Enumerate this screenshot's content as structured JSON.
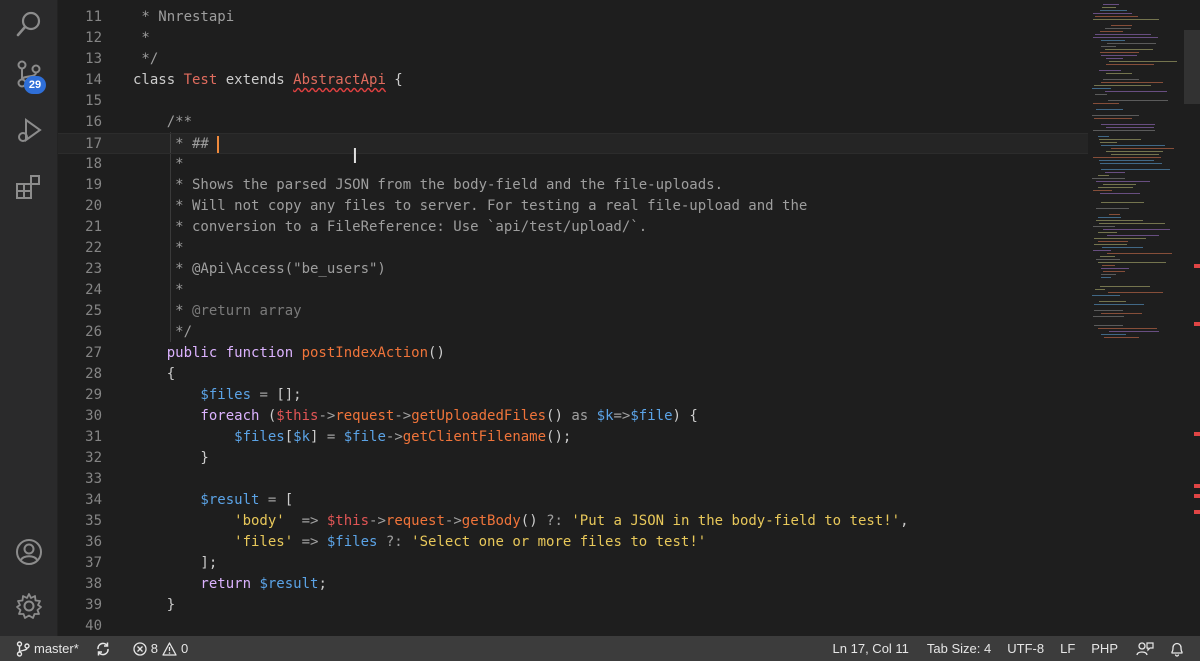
{
  "activity_bar": {
    "scm_badge": "29"
  },
  "editor": {
    "lines": [
      {
        "n": "11",
        "tokens": [
          [
            "cm",
            " * Nnrestapi"
          ]
        ]
      },
      {
        "n": "12",
        "tokens": [
          [
            "cm",
            " *"
          ]
        ]
      },
      {
        "n": "13",
        "tokens": [
          [
            "cm",
            " */"
          ]
        ]
      },
      {
        "n": "14",
        "tokens": [
          [
            "k",
            "class "
          ],
          [
            "cls",
            "Test"
          ],
          [
            "k",
            " extends "
          ],
          [
            "cls squig",
            "AbstractApi"
          ],
          [
            "k",
            " {"
          ]
        ]
      },
      {
        "n": "15",
        "tokens": []
      },
      {
        "n": "16",
        "tokens": [
          [
            "cm",
            "    /**"
          ]
        ]
      },
      {
        "n": "17",
        "tokens": [
          [
            "cm",
            "     * ## "
          ]
        ],
        "caret": true
      },
      {
        "n": "18",
        "tokens": [
          [
            "cm",
            "     *"
          ]
        ]
      },
      {
        "n": "19",
        "tokens": [
          [
            "cm",
            "     * Shows the parsed JSON from the body-field and the file-uploads."
          ]
        ]
      },
      {
        "n": "20",
        "tokens": [
          [
            "cm",
            "     * Will not copy any files to server. For testing a real file-upload and the"
          ]
        ]
      },
      {
        "n": "21",
        "tokens": [
          [
            "cm",
            "     * conversion to a FileReference: Use `api/test/upload/`."
          ]
        ]
      },
      {
        "n": "22",
        "tokens": [
          [
            "cm",
            "     *"
          ]
        ]
      },
      {
        "n": "23",
        "tokens": [
          [
            "cm",
            "     * @Api\\Access(\"be_users\")"
          ]
        ]
      },
      {
        "n": "24",
        "tokens": [
          [
            "cm",
            "     *"
          ]
        ]
      },
      {
        "n": "25",
        "tokens": [
          [
            "cm",
            "     * "
          ],
          [
            "cm2",
            "@return array"
          ]
        ]
      },
      {
        "n": "26",
        "tokens": [
          [
            "cm",
            "     */"
          ]
        ]
      },
      {
        "n": "27",
        "tokens": [
          [
            "kw",
            "    public function "
          ],
          [
            "fn",
            "postIndexAction"
          ],
          [
            "k",
            "()"
          ]
        ]
      },
      {
        "n": "28",
        "tokens": [
          [
            "k",
            "    {"
          ]
        ]
      },
      {
        "n": "29",
        "tokens": [
          [
            "var",
            "        $files"
          ],
          [
            "op",
            " = "
          ],
          [
            "k",
            "[];"
          ]
        ]
      },
      {
        "n": "30",
        "tokens": [
          [
            "kw",
            "        foreach "
          ],
          [
            "k",
            "("
          ],
          [
            "this",
            "$this"
          ],
          [
            "op",
            "->"
          ],
          [
            "fn",
            "request"
          ],
          [
            "op",
            "->"
          ],
          [
            "fn",
            "getUploadedFiles"
          ],
          [
            "k",
            "() "
          ],
          [
            "op",
            "as "
          ],
          [
            "var",
            "$k"
          ],
          [
            "op",
            "=>"
          ],
          [
            "var",
            "$file"
          ],
          [
            "k",
            ") {"
          ]
        ]
      },
      {
        "n": "31",
        "tokens": [
          [
            "var",
            "            $files"
          ],
          [
            "k",
            "["
          ],
          [
            "var",
            "$k"
          ],
          [
            "k",
            "] "
          ],
          [
            "op",
            "= "
          ],
          [
            "var",
            "$file"
          ],
          [
            "op",
            "->"
          ],
          [
            "fn",
            "getClientFilename"
          ],
          [
            "k",
            "();"
          ]
        ]
      },
      {
        "n": "32",
        "tokens": [
          [
            "k",
            "        }"
          ]
        ]
      },
      {
        "n": "33",
        "tokens": []
      },
      {
        "n": "34",
        "tokens": [
          [
            "var",
            "        $result"
          ],
          [
            "op",
            " = "
          ],
          [
            "k",
            "["
          ]
        ]
      },
      {
        "n": "35",
        "tokens": [
          [
            "str",
            "            'body'"
          ],
          [
            "op",
            "  => "
          ],
          [
            "this",
            "$this"
          ],
          [
            "op",
            "->"
          ],
          [
            "fn",
            "request"
          ],
          [
            "op",
            "->"
          ],
          [
            "fn",
            "getBody"
          ],
          [
            "k",
            "() "
          ],
          [
            "op",
            "?: "
          ],
          [
            "str",
            "'Put a JSON in the body-field to test!'"
          ],
          [
            "k",
            ","
          ]
        ]
      },
      {
        "n": "36",
        "tokens": [
          [
            "str",
            "            'files'"
          ],
          [
            "op",
            " => "
          ],
          [
            "var",
            "$files"
          ],
          [
            "op",
            " ?: "
          ],
          [
            "str",
            "'Select one or more files to test!'"
          ]
        ]
      },
      {
        "n": "37",
        "tokens": [
          [
            "k",
            "        ];"
          ]
        ]
      },
      {
        "n": "38",
        "tokens": [
          [
            "kw",
            "        return "
          ],
          [
            "var",
            "$result"
          ],
          [
            "k",
            ";"
          ]
        ]
      },
      {
        "n": "39",
        "tokens": [
          [
            "k",
            "    }"
          ]
        ]
      },
      {
        "n": "40",
        "tokens": []
      }
    ]
  },
  "status_bar": {
    "branch": "master*",
    "errors": "8",
    "warnings": "0",
    "position": "Ln 17, Col 11",
    "tab_size": "Tab Size: 4",
    "encoding": "UTF-8",
    "eol": "LF",
    "language": "PHP"
  },
  "icons": [
    "search-icon",
    "source-control-icon",
    "run-debug-icon",
    "extensions-icon",
    "account-icon",
    "settings-gear-icon",
    "git-branch-icon",
    "sync-icon",
    "error-icon",
    "warning-icon",
    "feedback-icon",
    "bell-icon"
  ]
}
